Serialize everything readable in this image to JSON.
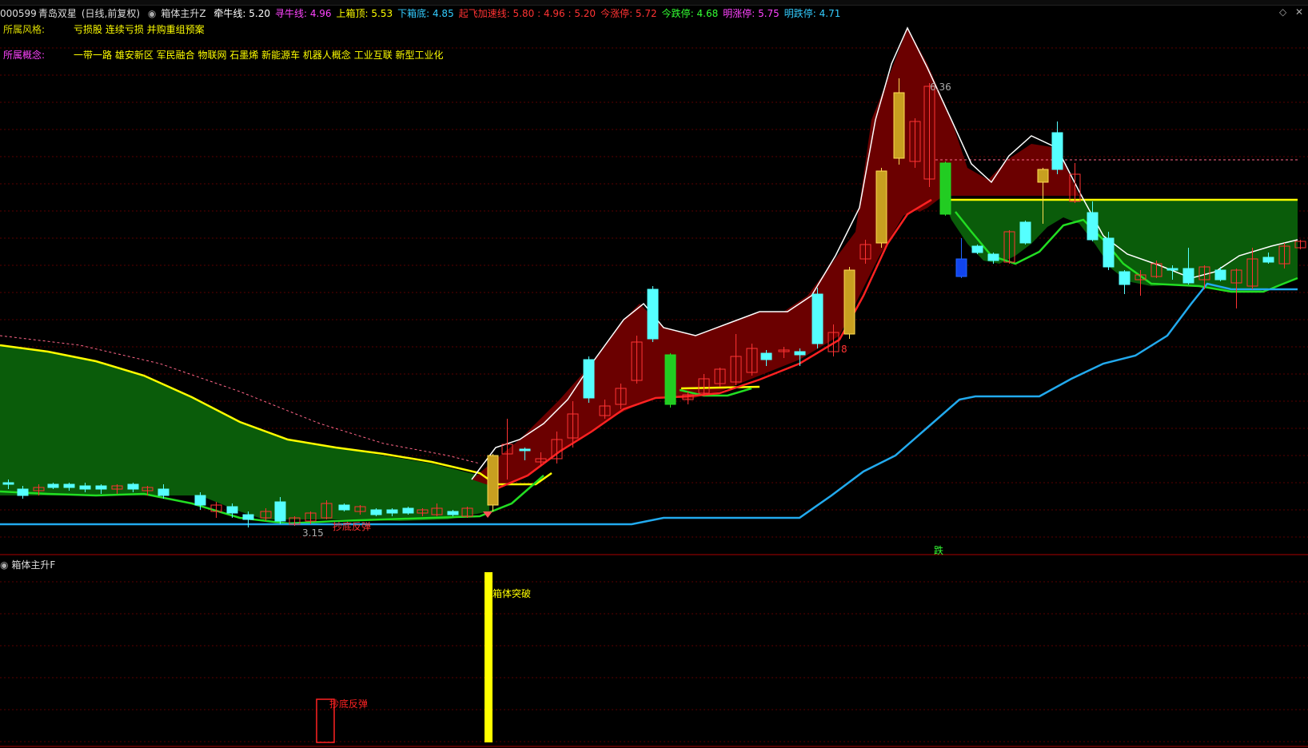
{
  "header": {
    "stock_code": "000599",
    "stock_name": "青岛双星",
    "period": "(日线,前复权)",
    "indicator": "箱体主升Z",
    "fields": [
      {
        "label": "牵牛线:",
        "value": "5.20",
        "color": "#ffffff"
      },
      {
        "label": "寻牛线:",
        "value": "4.96",
        "color": "#ff44ff"
      },
      {
        "label": "上箱顶:",
        "value": "5.53",
        "color": "#ffff00"
      },
      {
        "label": "下箱底:",
        "value": "4.85",
        "color": "#33ccff"
      },
      {
        "label": "起飞加速线:",
        "value": "5.80 : 4.96 : 5.20",
        "color": "#ff3333"
      },
      {
        "label": "今涨停:",
        "value": "5.72",
        "color": "#ff3333"
      },
      {
        "label": "今跌停:",
        "value": "4.68",
        "color": "#33ff33"
      },
      {
        "label": "明涨停:",
        "value": "5.75",
        "color": "#ff44ff"
      },
      {
        "label": "明跌停:",
        "value": "4.71",
        "color": "#33ccff"
      }
    ]
  },
  "info": {
    "style_label": "所属风格:",
    "style_value": "亏损股 连续亏损 并购重组预案",
    "concept_label": "所属概念:",
    "concept_value": "一带一路 雄安新区 军民融合 物联网 石墨烯 新能源车 机器人概念 工业互联 新型工业化"
  },
  "annotations": {
    "high_price": "6.36",
    "low_price": "3.15",
    "bottom_rebound": "抄底反弹",
    "fall": "跌",
    "signal_mark": "8"
  },
  "sub_panel": {
    "title": "箱体主升F",
    "breakout_label": "箱体突破",
    "rebound_label": "抄底反弹"
  },
  "colors": {
    "up": "#ff3333",
    "down": "#55ffff",
    "grid": "#6a0000",
    "yellow": "#ffff00",
    "green_line": "#22dd22",
    "blue_line": "#22aaee",
    "red_line": "#ff2222",
    "fill_red": "#6b0000",
    "fill_green": "#0a5c0a"
  },
  "icons": {
    "collapse": "circle-icon",
    "diamond": "diamond-icon",
    "close": "close-icon"
  }
}
